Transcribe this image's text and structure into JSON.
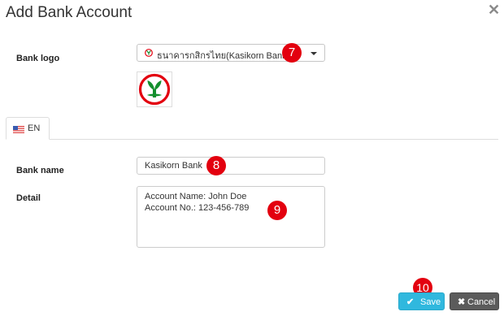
{
  "modal": {
    "title": "Add Bank Account",
    "close_icon": "close-icon"
  },
  "form": {
    "bank_logo_label": "Bank logo",
    "bank_logo_select": {
      "selected": "ธนาคารกสิกรไทย(Kasikorn Bank)",
      "icon": "kasikorn-bank-icon"
    },
    "logo_preview": "kasikorn-bank-logo",
    "tabs": [
      {
        "label": "EN",
        "icon": "us-flag-icon",
        "active": true
      }
    ],
    "bank_name_label": "Bank name",
    "bank_name_value": "Kasikorn Bank",
    "detail_label": "Detail",
    "detail_value": "Account Name: John Doe\nAccount No.: 123-456-789"
  },
  "buttons": {
    "save_label": "Save",
    "cancel_label": "Cancel"
  },
  "annotations": {
    "step_7": "7",
    "step_8": "8",
    "step_9": "9",
    "step_10": "10"
  },
  "colors": {
    "save_button": "#30b8de",
    "cancel_button": "#5b5b5b",
    "badge": "#e3000f",
    "kasikorn_green": "#138f2d",
    "kasikorn_red": "#e3000f"
  }
}
